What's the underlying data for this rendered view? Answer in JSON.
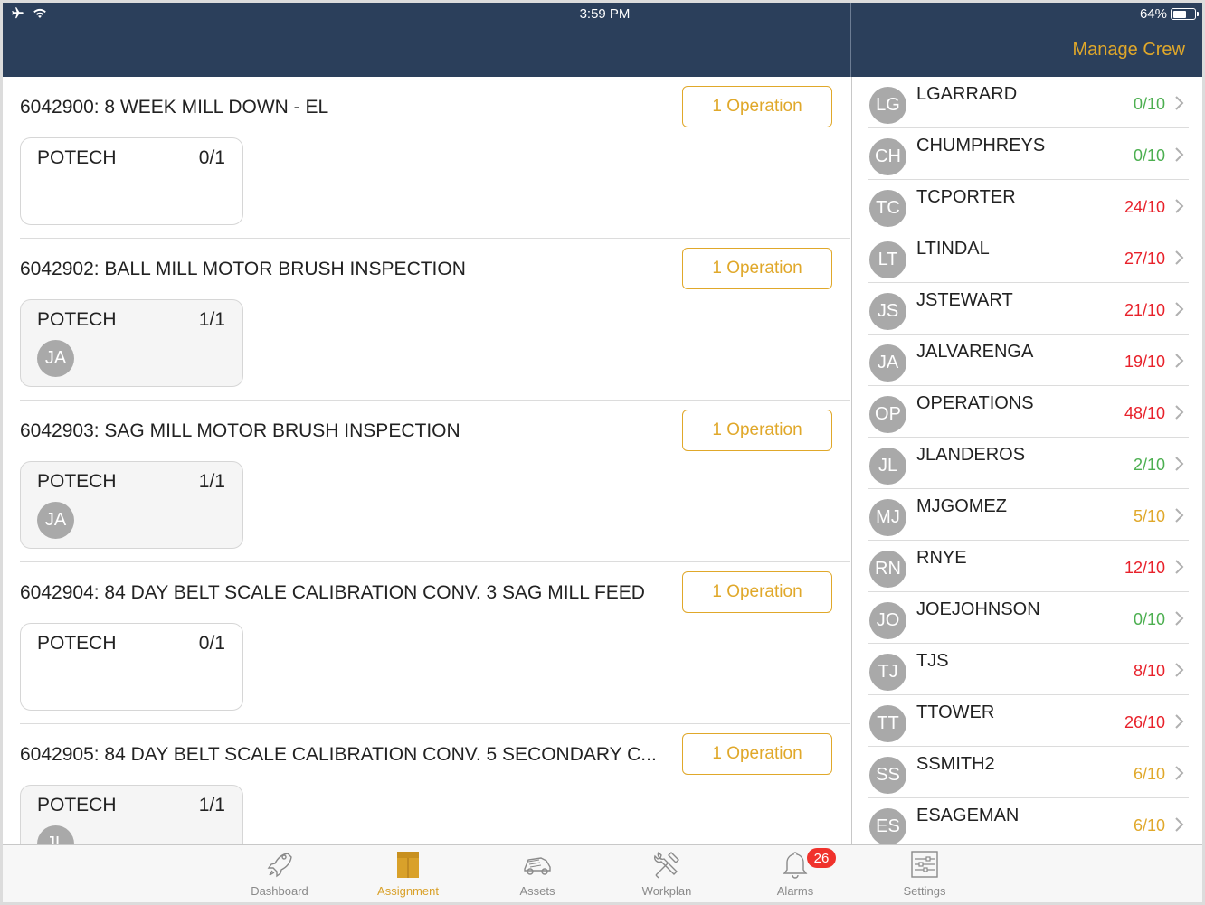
{
  "status_bar": {
    "time": "3:59 PM",
    "battery": "64%",
    "battery_level": 0.64,
    "icons": [
      "airplane-icon",
      "wifi-icon",
      "battery-icon"
    ]
  },
  "header": {
    "manage_crew": "Manage Crew"
  },
  "colors": {
    "nav_bg": "#2b3f5b",
    "accent": "#e0a82a",
    "green": "#4caf50",
    "red": "#e8212a",
    "orange": "#e0a82a"
  },
  "work_orders": [
    {
      "title": "6042900: 8 WEEK MILL DOWN - EL",
      "button": "1 Operation",
      "craft": "POTECH",
      "count": "0/1",
      "avatar": ""
    },
    {
      "title": "6042902: BALL MILL MOTOR BRUSH INSPECTION",
      "button": "1 Operation",
      "craft": "POTECH",
      "count": "1/1",
      "avatar": "JA"
    },
    {
      "title": "6042903: SAG MILL MOTOR BRUSH INSPECTION",
      "button": "1 Operation",
      "craft": "POTECH",
      "count": "1/1",
      "avatar": "JA"
    },
    {
      "title": "6042904: 84 DAY BELT SCALE CALIBRATION CONV. 3 SAG MILL FEED",
      "button": "1 Operation",
      "craft": "POTECH",
      "count": "0/1",
      "avatar": ""
    },
    {
      "title": "6042905: 84 DAY BELT SCALE CALIBRATION CONV. 5 SECONDARY C...",
      "button": "1 Operation",
      "craft": "POTECH",
      "count": "1/1",
      "avatar": "JL"
    }
  ],
  "crew": [
    {
      "initials": "LG",
      "name": "LGARRARD",
      "hours": "0/10",
      "status": "green"
    },
    {
      "initials": "CH",
      "name": "CHUMPHREYS",
      "hours": "0/10",
      "status": "green"
    },
    {
      "initials": "TC",
      "name": "TCPORTER",
      "hours": "24/10",
      "status": "red"
    },
    {
      "initials": "LT",
      "name": "LTINDAL",
      "hours": "27/10",
      "status": "red"
    },
    {
      "initials": "JS",
      "name": "JSTEWART",
      "hours": "21/10",
      "status": "red"
    },
    {
      "initials": "JA",
      "name": "JALVARENGA",
      "hours": "19/10",
      "status": "red"
    },
    {
      "initials": "OP",
      "name": "OPERATIONS",
      "hours": "48/10",
      "status": "red"
    },
    {
      "initials": "JL",
      "name": "JLANDEROS",
      "hours": "2/10",
      "status": "green"
    },
    {
      "initials": "MJ",
      "name": "MJGOMEZ",
      "hours": "5/10",
      "status": "orange"
    },
    {
      "initials": "RN",
      "name": "RNYE",
      "hours": "12/10",
      "status": "red"
    },
    {
      "initials": "JO",
      "name": "JOEJOHNSON",
      "hours": "0/10",
      "status": "green"
    },
    {
      "initials": "TJ",
      "name": "TJS",
      "hours": "8/10",
      "status": "red"
    },
    {
      "initials": "TT",
      "name": "TTOWER",
      "hours": "26/10",
      "status": "red"
    },
    {
      "initials": "SS",
      "name": "SSMITH2",
      "hours": "6/10",
      "status": "orange"
    },
    {
      "initials": "ES",
      "name": "ESAGEMAN",
      "hours": "6/10",
      "status": "orange"
    }
  ],
  "tabs": [
    {
      "label": "Dashboard",
      "icon": "rocket-icon",
      "active": false
    },
    {
      "label": "Assignment",
      "icon": "envelope-icon",
      "active": true
    },
    {
      "label": "Assets",
      "icon": "truck-icon",
      "active": false
    },
    {
      "label": "Workplan",
      "icon": "tools-icon",
      "active": false
    },
    {
      "label": "Alarms",
      "icon": "bell-icon",
      "active": false,
      "badge": "26"
    },
    {
      "label": "Settings",
      "icon": "sliders-icon",
      "active": false
    }
  ]
}
